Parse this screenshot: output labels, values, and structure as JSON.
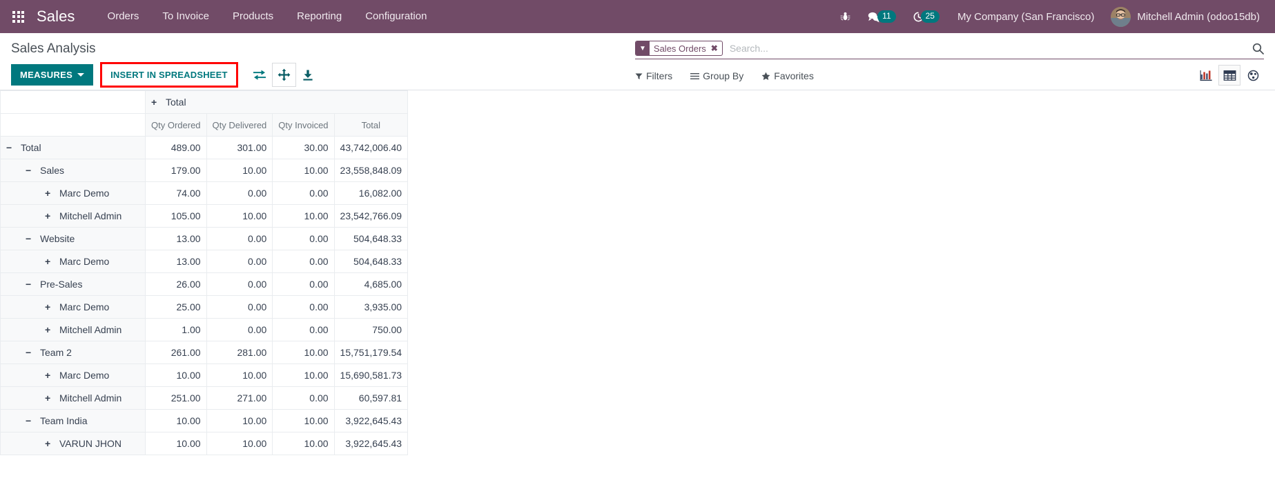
{
  "navbar": {
    "apps_icon": "apps-grid-icon",
    "brand": "Sales",
    "menu": [
      {
        "label": "Orders"
      },
      {
        "label": "To Invoice"
      },
      {
        "label": "Products"
      },
      {
        "label": "Reporting"
      },
      {
        "label": "Configuration"
      }
    ],
    "bug_icon": "bug-icon",
    "messages_icon": "messages-icon",
    "messages_count": "11",
    "activities_icon": "clock-icon",
    "activities_count": "25",
    "company": "My Company (San Francisco)",
    "user": "Mitchell Admin (odoo15db)",
    "avatar_icon": "user-avatar",
    "brand_color": "#714b67",
    "badge_color": "#00787e"
  },
  "control_panel": {
    "title": "Sales Analysis",
    "measures_label": "MEASURES",
    "measures_caret": "chevron-down-icon",
    "insert_label": "INSERT IN SPREADSHEET",
    "highlight_color": "#ff0000",
    "accent_color": "#00787e",
    "icons": [
      {
        "name": "flip-axis-icon",
        "title": "Flip axis"
      },
      {
        "name": "expand-all-icon",
        "title": "Expand all"
      },
      {
        "name": "download-xlsx-icon",
        "title": "Download xlsx"
      }
    ]
  },
  "search": {
    "facet_label": "Sales Orders",
    "facet_icon": "filter-icon",
    "facet_remove_icon": "close-icon",
    "placeholder": "Search...",
    "value": "",
    "magnifier_icon": "search-icon",
    "filters_label": "Filters",
    "filters_icon": "filter-caret-icon",
    "groupby_label": "Group By",
    "groupby_icon": "bars-icon",
    "favorites_label": "Favorites",
    "favorites_icon": "star-icon"
  },
  "view_switcher": {
    "views": [
      {
        "name": "graph-view-icon",
        "label": "Graph",
        "active": false
      },
      {
        "name": "pivot-view-icon",
        "label": "Pivot",
        "active": true
      },
      {
        "name": "cohort-view-icon",
        "label": "Cohort",
        "active": false
      }
    ]
  },
  "pivot": {
    "col_group_header": "Total",
    "col_group_toggle": "+",
    "measures": [
      "Qty Ordered",
      "Qty Delivered",
      "Qty Invoiced",
      "Total"
    ],
    "rows": [
      {
        "level": 0,
        "toggle": "−",
        "label": "Total",
        "values": [
          "489.00",
          "301.00",
          "30.00",
          "43,742,006.40"
        ]
      },
      {
        "level": 1,
        "toggle": "−",
        "label": "Sales",
        "values": [
          "179.00",
          "10.00",
          "10.00",
          "23,558,848.09"
        ]
      },
      {
        "level": 2,
        "toggle": "+",
        "label": "Marc Demo",
        "values": [
          "74.00",
          "0.00",
          "0.00",
          "16,082.00"
        ]
      },
      {
        "level": 2,
        "toggle": "+",
        "label": "Mitchell Admin",
        "values": [
          "105.00",
          "10.00",
          "10.00",
          "23,542,766.09"
        ]
      },
      {
        "level": 1,
        "toggle": "−",
        "label": "Website",
        "values": [
          "13.00",
          "0.00",
          "0.00",
          "504,648.33"
        ]
      },
      {
        "level": 2,
        "toggle": "+",
        "label": "Marc Demo",
        "values": [
          "13.00",
          "0.00",
          "0.00",
          "504,648.33"
        ]
      },
      {
        "level": 1,
        "toggle": "−",
        "label": "Pre-Sales",
        "values": [
          "26.00",
          "0.00",
          "0.00",
          "4,685.00"
        ]
      },
      {
        "level": 2,
        "toggle": "+",
        "label": "Marc Demo",
        "values": [
          "25.00",
          "0.00",
          "0.00",
          "3,935.00"
        ]
      },
      {
        "level": 2,
        "toggle": "+",
        "label": "Mitchell Admin",
        "values": [
          "1.00",
          "0.00",
          "0.00",
          "750.00"
        ]
      },
      {
        "level": 1,
        "toggle": "−",
        "label": "Team 2",
        "values": [
          "261.00",
          "281.00",
          "10.00",
          "15,751,179.54"
        ]
      },
      {
        "level": 2,
        "toggle": "+",
        "label": "Marc Demo",
        "values": [
          "10.00",
          "10.00",
          "10.00",
          "15,690,581.73"
        ]
      },
      {
        "level": 2,
        "toggle": "+",
        "label": "Mitchell Admin",
        "values": [
          "251.00",
          "271.00",
          "0.00",
          "60,597.81"
        ]
      },
      {
        "level": 1,
        "toggle": "−",
        "label": "Team India",
        "values": [
          "10.00",
          "10.00",
          "10.00",
          "3,922,645.43"
        ]
      },
      {
        "level": 2,
        "toggle": "+",
        "label": "VARUN JHON",
        "values": [
          "10.00",
          "10.00",
          "10.00",
          "3,922,645.43"
        ]
      }
    ]
  }
}
